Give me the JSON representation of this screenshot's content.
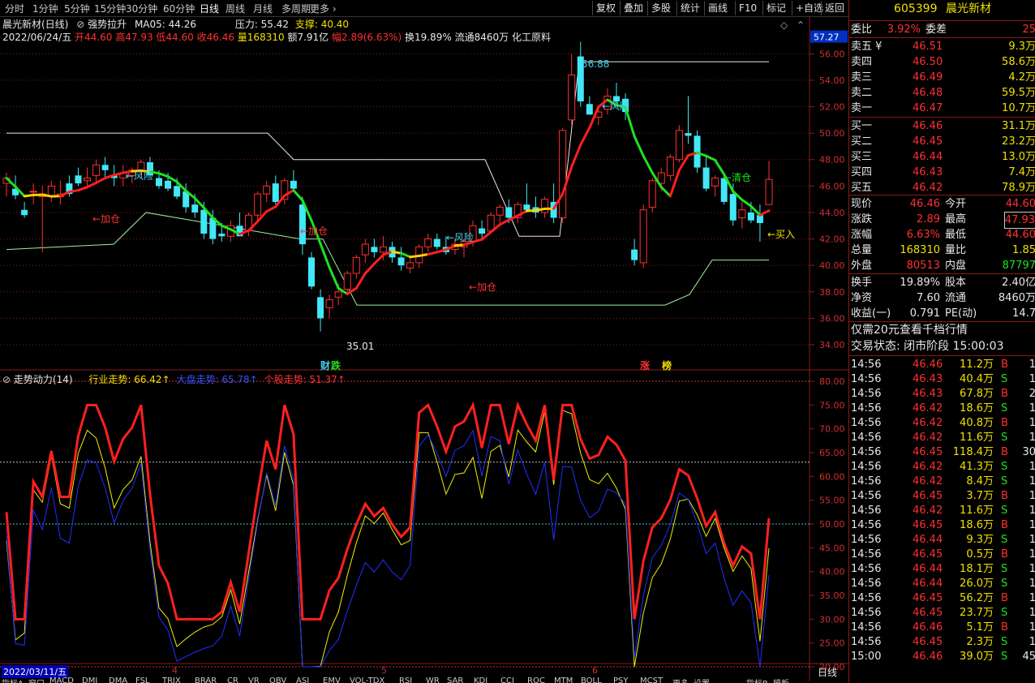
{
  "toolbar": {
    "periods": [
      "分时",
      "1分钟",
      "5分钟",
      "15分钟",
      "30分钟",
      "60分钟",
      "日线",
      "周线",
      "月线",
      "多周期",
      "更多"
    ],
    "active_period": "日线",
    "buttons": [
      "复权",
      "叠加",
      "多股",
      "统计",
      "画线",
      "F10",
      "标记",
      "+自选",
      "返回"
    ]
  },
  "chart_header": {
    "title": "晨光新材(日线)",
    "indicator": "强势拉升",
    "ma": "MA05: 44.26",
    "pressure": "压力: 55.42",
    "support": "支撑: 40.40",
    "date": "2022/06/24/五",
    "open": "开44.60",
    "high": "高47.93",
    "low": "低44.60",
    "close": "收46.46",
    "volume": "量168310",
    "amount": "额7.91亿",
    "change": "幅2.89(6.63%)",
    "turnover": "换19.89%",
    "float": "流通8460万",
    "industry": "化工原料"
  },
  "price_axis": {
    "labels": [
      "56.00",
      "54.00",
      "52.00",
      "50.00",
      "48.00",
      "46.00",
      "44.00",
      "42.00",
      "40.00",
      "38.00",
      "36.00",
      "34.00"
    ],
    "current": "57.27"
  },
  "chart_annotations": {
    "high_label": "56.88",
    "low_label": "35.01",
    "risk": "←风险",
    "add": "←加仓",
    "clear": "←清仓",
    "buy": "←买入",
    "event1": "财",
    "event2": "跌",
    "event3": "涨",
    "event4": "榜"
  },
  "lower_panel": {
    "title": "走势动力(14)",
    "industry": "行业走势: 66.42↑",
    "market": "大盘走势: 65.78↑",
    "stock": "个股走势: 51.37↑",
    "axis": [
      "80.00",
      "75.00",
      "70.00",
      "65.00",
      "60.00",
      "55.00",
      "50.00",
      "45.00",
      "40.00",
      "35.00",
      "30.00",
      "25.00",
      "20.00"
    ]
  },
  "date_axis": {
    "start": "2022/03/11/五",
    "m4": "4",
    "m5": "5",
    "m6": "6",
    "period": "日线"
  },
  "bottom_tabs": [
    "指标A",
    "窗口",
    "MACD",
    "DMI",
    "DMA",
    "FSL",
    "TRIX",
    "BRAR",
    "CR",
    "VR",
    "OBV",
    "ASI",
    "EMV",
    "VOL-TDX",
    "RSI",
    "WR",
    "SAR",
    "KDJ",
    "CCI",
    "ROC",
    "MTM",
    "BOLL",
    "PSY",
    "MCST",
    "更多",
    "设置",
    "指标B",
    "模板"
  ],
  "quote": {
    "code": "605399",
    "name": "晨光新材",
    "wb_label": "委比",
    "wb_value": "3.92%",
    "wc_label": "委差",
    "wc_value": "25",
    "asks": [
      {
        "label": "卖五",
        "price": "46.51",
        "vol": "9.3万"
      },
      {
        "label": "卖四",
        "price": "46.50",
        "vol": "58.6万"
      },
      {
        "label": "卖三",
        "price": "46.49",
        "vol": "4.2万"
      },
      {
        "label": "卖二",
        "price": "46.48",
        "vol": "59.5万"
      },
      {
        "label": "卖一",
        "price": "46.47",
        "vol": "10.7万"
      }
    ],
    "bids": [
      {
        "label": "买一",
        "price": "46.46",
        "vol": "31.1万"
      },
      {
        "label": "买二",
        "price": "46.45",
        "vol": "23.2万"
      },
      {
        "label": "买三",
        "price": "46.44",
        "vol": "13.0万"
      },
      {
        "label": "买四",
        "price": "46.43",
        "vol": "7.4万"
      },
      {
        "label": "买五",
        "price": "46.42",
        "vol": "78.9万"
      }
    ],
    "stats": [
      {
        "l1": "现价",
        "v1": "46.46",
        "l2": "今开",
        "v2": "44.60"
      },
      {
        "l1": "涨跌",
        "v1": "2.89",
        "l2": "最高",
        "v2": "47.93"
      },
      {
        "l1": "涨幅",
        "v1": "6.63%",
        "l2": "最低",
        "v2": "44.60"
      },
      {
        "l1": "总量",
        "v1": "168310",
        "l2": "量比",
        "v2": "1.85"
      },
      {
        "l1": "外盘",
        "v1": "80513",
        "l2": "内盘",
        "v2": "87797"
      }
    ],
    "stats2": [
      {
        "l1": "换手",
        "v1": "19.89%",
        "l2": "股本",
        "v2": "2.40亿"
      },
      {
        "l1": "净资",
        "v1": "7.60",
        "l2": "流通",
        "v2": "8460万"
      },
      {
        "l1": "收益(一)",
        "v1": "0.791",
        "l2": "PE(动)",
        "v2": "14.7"
      }
    ],
    "promo": "仅需20元查看千档行情",
    "status": "交易状态: 闭市阶段 15:00:03"
  },
  "ticks": [
    {
      "t": "14:56",
      "p": "46.46",
      "v": "11.2万",
      "d": "B",
      "n": "1"
    },
    {
      "t": "14:56",
      "p": "46.43",
      "v": "40.4万",
      "d": "S",
      "n": "1"
    },
    {
      "t": "14:56",
      "p": "46.43",
      "v": "67.8万",
      "d": "B",
      "n": "2"
    },
    {
      "t": "14:56",
      "p": "46.42",
      "v": "18.6万",
      "d": "S",
      "n": "1"
    },
    {
      "t": "14:56",
      "p": "46.42",
      "v": "40.8万",
      "d": "B",
      "n": "1"
    },
    {
      "t": "14:56",
      "p": "46.42",
      "v": "11.6万",
      "d": "S",
      "n": "1"
    },
    {
      "t": "14:56",
      "p": "46.45",
      "v": "118.4万",
      "d": "B",
      "n": "30"
    },
    {
      "t": "14:56",
      "p": "46.42",
      "v": "41.3万",
      "d": "S",
      "n": "1"
    },
    {
      "t": "14:56",
      "p": "46.42",
      "v": "8.4万",
      "d": "S",
      "n": "1"
    },
    {
      "t": "14:56",
      "p": "46.45",
      "v": "3.7万",
      "d": "B",
      "n": "1"
    },
    {
      "t": "14:56",
      "p": "46.42",
      "v": "11.6万",
      "d": "S",
      "n": "1"
    },
    {
      "t": "14:56",
      "p": "46.45",
      "v": "18.6万",
      "d": "B",
      "n": "1"
    },
    {
      "t": "14:56",
      "p": "46.44",
      "v": "9.3万",
      "d": "S",
      "n": "1"
    },
    {
      "t": "14:56",
      "p": "46.45",
      "v": "0.5万",
      "d": "B",
      "n": "1"
    },
    {
      "t": "14:56",
      "p": "46.44",
      "v": "18.1万",
      "d": "S",
      "n": "1"
    },
    {
      "t": "14:56",
      "p": "46.44",
      "v": "26.0万",
      "d": "S",
      "n": "1"
    },
    {
      "t": "14:56",
      "p": "46.45",
      "v": "56.2万",
      "d": "B",
      "n": "1"
    },
    {
      "t": "14:56",
      "p": "46.45",
      "v": "23.7万",
      "d": "S",
      "n": "1"
    },
    {
      "t": "14:56",
      "p": "46.46",
      "v": "5.1万",
      "d": "B",
      "n": "1"
    },
    {
      "t": "14:56",
      "p": "46.45",
      "v": "2.3万",
      "d": "S",
      "n": "1"
    },
    {
      "t": "15:00",
      "p": "46.46",
      "v": "39.0万",
      "d": "S",
      "n": "45"
    }
  ],
  "colors": {
    "up": "#ff3030",
    "down": "#40e8f8",
    "ma_up": "#ff2020",
    "ma_mid": "#ffd000",
    "ma_down": "#20e020",
    "grid": "#8a1a1a"
  },
  "chart_data": {
    "type": "candlestick",
    "ylim": [
      34,
      57
    ],
    "candles": [
      [
        46.2,
        47.0,
        45.2,
        46.6
      ],
      [
        45.8,
        46.8,
        45.0,
        45.3
      ],
      [
        44.2,
        44.8,
        43.6,
        43.8
      ],
      [
        45.6,
        46.2,
        44.6,
        45.6
      ],
      [
        45.2,
        46.0,
        41.0,
        45.4
      ],
      [
        45.2,
        46.4,
        44.8,
        46.0
      ],
      [
        45.2,
        46.4,
        44.6,
        45.4
      ],
      [
        46.2,
        46.8,
        45.2,
        45.4
      ],
      [
        46.8,
        47.4,
        46.0,
        46.2
      ],
      [
        46.4,
        47.4,
        45.8,
        46.6
      ],
      [
        46.8,
        48.0,
        46.2,
        47.6
      ],
      [
        47.6,
        48.2,
        46.6,
        47.2
      ],
      [
        46.8,
        47.6,
        46.0,
        46.6
      ],
      [
        46.6,
        47.6,
        46.0,
        47.0
      ],
      [
        46.8,
        47.4,
        46.2,
        47.2
      ],
      [
        47.2,
        48.0,
        46.6,
        47.8
      ],
      [
        47.8,
        48.2,
        46.6,
        46.8
      ],
      [
        46.6,
        47.2,
        45.8,
        46.0
      ],
      [
        46.4,
        47.0,
        45.6,
        45.8
      ],
      [
        46.0,
        46.6,
        45.0,
        45.2
      ],
      [
        45.6,
        46.2,
        44.0,
        44.4
      ],
      [
        44.6,
        45.4,
        43.6,
        44.0
      ],
      [
        44.2,
        44.8,
        42.0,
        42.4
      ],
      [
        43.6,
        44.2,
        41.6,
        42.0
      ],
      [
        42.4,
        43.2,
        41.8,
        42.2
      ],
      [
        42.2,
        43.4,
        41.8,
        43.0
      ],
      [
        43.0,
        44.0,
        42.2,
        42.2
      ],
      [
        42.6,
        44.0,
        42.2,
        43.8
      ],
      [
        43.8,
        45.6,
        43.2,
        45.4
      ],
      [
        45.4,
        46.4,
        44.8,
        46.0
      ],
      [
        46.2,
        46.8,
        44.6,
        44.8
      ],
      [
        45.0,
        46.6,
        44.6,
        46.4
      ],
      [
        46.4,
        47.2,
        45.6,
        45.8
      ],
      [
        44.6,
        45.2,
        40.8,
        41.6
      ],
      [
        40.6,
        41.0,
        38.2,
        38.4
      ],
      [
        37.6,
        38.2,
        35.0,
        36.0
      ],
      [
        36.8,
        37.8,
        36.0,
        37.4
      ],
      [
        37.6,
        38.6,
        37.0,
        38.0
      ],
      [
        38.2,
        39.6,
        37.8,
        39.4
      ],
      [
        39.4,
        40.8,
        39.0,
        40.6
      ],
      [
        40.8,
        42.0,
        40.2,
        41.6
      ],
      [
        41.4,
        42.0,
        40.6,
        41.0
      ],
      [
        41.0,
        42.2,
        40.4,
        41.4
      ],
      [
        41.4,
        41.8,
        40.2,
        40.6
      ],
      [
        40.6,
        41.4,
        39.6,
        40.0
      ],
      [
        39.8,
        40.6,
        39.4,
        40.2
      ],
      [
        40.2,
        41.6,
        39.8,
        41.4
      ],
      [
        41.4,
        42.4,
        41.0,
        42.0
      ],
      [
        42.0,
        42.4,
        41.2,
        41.4
      ],
      [
        41.4,
        42.2,
        40.8,
        41.0
      ],
      [
        41.2,
        42.0,
        40.8,
        41.6
      ],
      [
        41.4,
        42.0,
        40.6,
        41.8
      ],
      [
        41.8,
        43.4,
        41.4,
        43.0
      ],
      [
        42.8,
        43.4,
        42.0,
        42.4
      ],
      [
        42.6,
        44.0,
        42.4,
        43.8
      ],
      [
        43.8,
        44.6,
        43.2,
        44.4
      ],
      [
        44.4,
        45.0,
        43.2,
        43.6
      ],
      [
        43.6,
        44.8,
        43.2,
        44.6
      ],
      [
        44.6,
        46.2,
        44.0,
        44.2
      ],
      [
        44.4,
        45.2,
        43.6,
        44.0
      ],
      [
        44.0,
        45.2,
        43.6,
        45.0
      ],
      [
        44.8,
        46.2,
        43.2,
        43.6
      ],
      [
        43.6,
        50.4,
        43.2,
        50.2
      ],
      [
        51.0,
        56.0,
        50.6,
        54.4
      ],
      [
        55.8,
        56.9,
        52.0,
        52.4
      ],
      [
        52.2,
        52.8,
        51.6,
        51.4
      ],
      [
        51.2,
        52.0,
        50.6,
        51.6
      ],
      [
        51.8,
        53.4,
        51.4,
        52.8
      ],
      [
        52.8,
        53.8,
        52.0,
        52.4
      ],
      [
        52.6,
        53.0,
        51.0,
        51.6
      ],
      [
        41.2,
        42.0,
        40.0,
        40.4
      ],
      [
        40.2,
        44.6,
        39.8,
        44.2
      ],
      [
        44.4,
        46.6,
        44.0,
        46.4
      ],
      [
        46.2,
        47.4,
        45.6,
        47.0
      ],
      [
        46.8,
        48.4,
        46.4,
        48.2
      ],
      [
        48.0,
        50.6,
        47.8,
        50.2
      ],
      [
        50.0,
        52.8,
        49.2,
        49.8
      ],
      [
        49.8,
        50.2,
        47.0,
        47.4
      ],
      [
        47.4,
        48.2,
        45.6,
        45.8
      ],
      [
        46.0,
        46.8,
        45.2,
        46.6
      ],
      [
        46.6,
        47.0,
        44.6,
        44.8
      ],
      [
        45.4,
        46.2,
        43.0,
        43.4
      ],
      [
        43.6,
        44.8,
        42.8,
        44.2
      ],
      [
        44.0,
        44.8,
        43.2,
        43.4
      ],
      [
        43.8,
        44.6,
        41.8,
        43.2
      ],
      [
        44.6,
        47.9,
        44.6,
        46.5
      ]
    ]
  }
}
